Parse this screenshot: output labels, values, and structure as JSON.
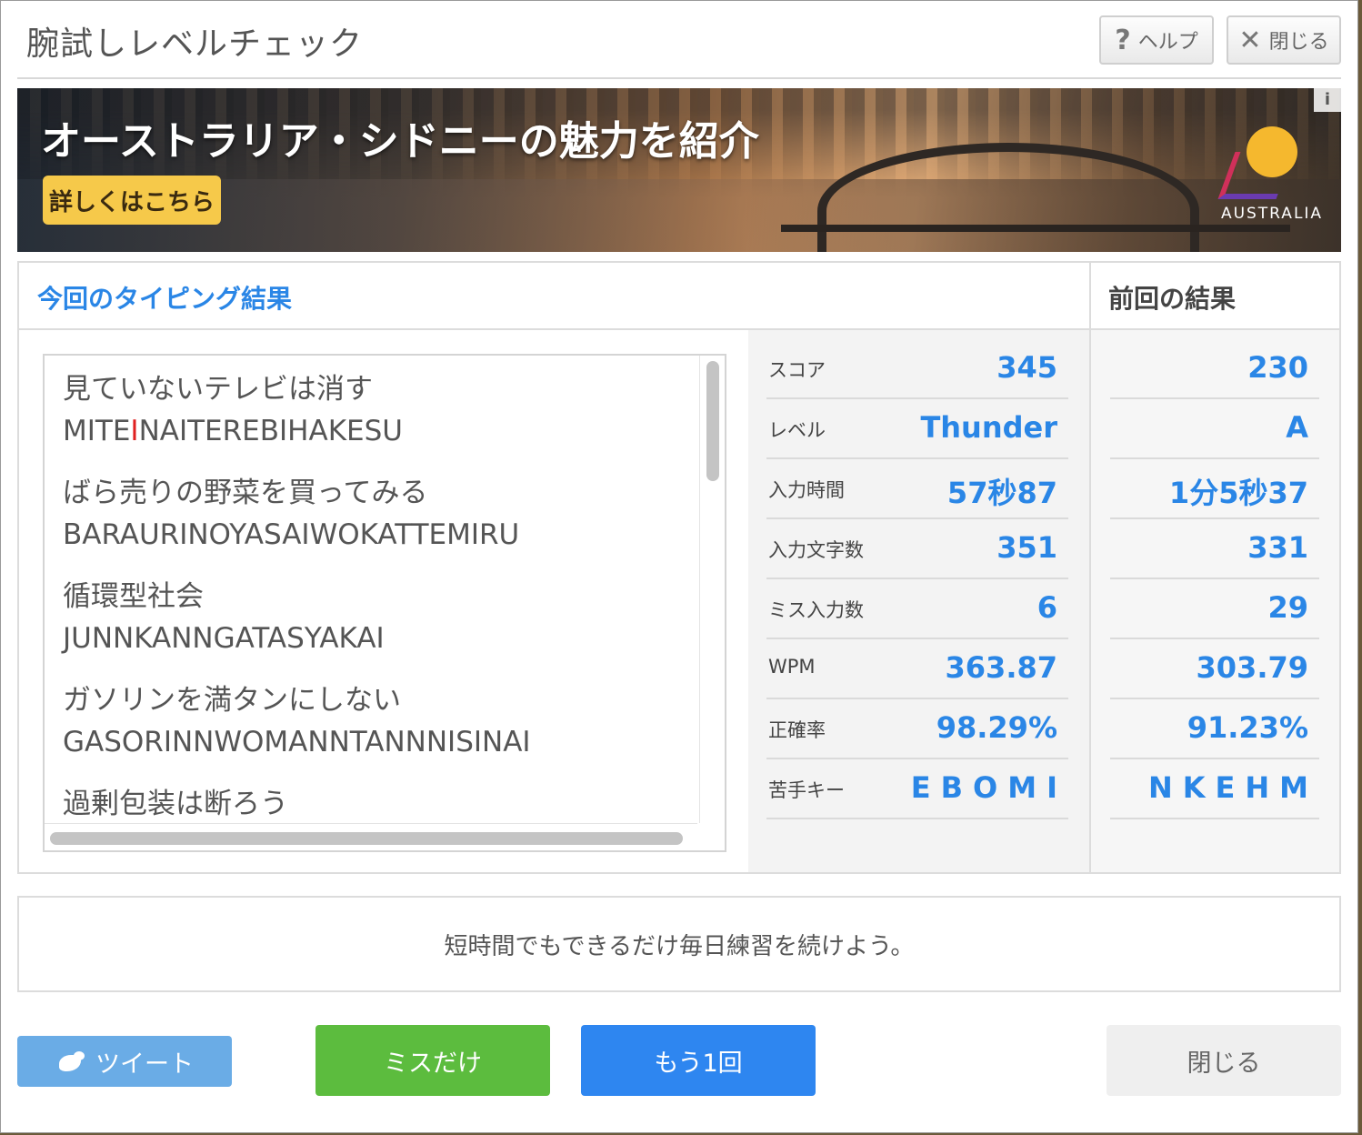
{
  "dialog": {
    "title": "腕試しレベルチェック",
    "help_label": "ヘルプ",
    "help_icon": "?",
    "close_label": "閉じる",
    "close_icon": "✕"
  },
  "banner": {
    "headline": "オーストラリア・シドニーの魅力を紹介",
    "cta": "詳しくはこちら",
    "info": "i",
    "brand": "AUSTRALIA"
  },
  "results": {
    "current_title": "今回のタイピング結果",
    "previous_title": "前回の結果",
    "entries": [
      {
        "japanese": "見ていないテレビは消す",
        "romaji_before": "MITE",
        "romaji_error": "I",
        "romaji_after": "NAITEREBIHAKESU"
      },
      {
        "japanese": "ばら売りの野菜を買ってみる",
        "romaji": "BARAURINOYASAIWOKATTEMIRU"
      },
      {
        "japanese": "循環型社会",
        "romaji": "JUNNKANNGATASYAKAI"
      },
      {
        "japanese": "ガソリンを満タンにしない",
        "romaji": "GASORINNWOMANNTANNNISINAI"
      },
      {
        "japanese": "過剰包装は断ろう",
        "romaji": ""
      }
    ],
    "stats": [
      {
        "label": "スコア",
        "current": "345",
        "previous": "230"
      },
      {
        "label": "レベル",
        "current": "Thunder",
        "previous": "A"
      },
      {
        "label": "入力時間",
        "current": "57秒87",
        "previous": "1分5秒37"
      },
      {
        "label": "入力文字数",
        "current": "351",
        "previous": "331"
      },
      {
        "label": "ミス入力数",
        "current": "6",
        "previous": "29"
      },
      {
        "label": "WPM",
        "current": "363.87",
        "previous": "303.79"
      },
      {
        "label": "正確率",
        "current": "98.29%",
        "previous": "91.23%"
      },
      {
        "label": "苦手キー",
        "current": "EBOMI",
        "previous": "NKEHM"
      }
    ]
  },
  "tip": "短時間でもできるだけ毎日練習を続けよう。",
  "buttons": {
    "tweet": "ツイート",
    "miss_only": "ミスだけ",
    "retry": "もう1回",
    "close": "閉じる"
  },
  "colors": {
    "accent_blue": "#2a86e6",
    "tweet": "#6aace6",
    "miss_only": "#5cbc3e",
    "retry": "#2e86f0",
    "close_btn": "#efefef",
    "error_char": "#e02020",
    "banner_cta": "#f6c94a"
  }
}
